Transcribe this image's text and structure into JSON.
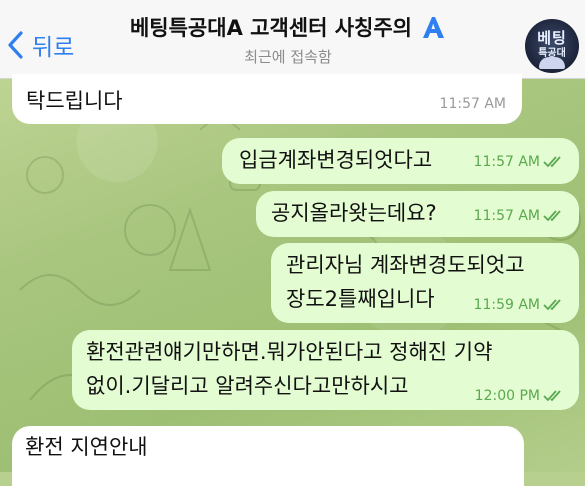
{
  "header": {
    "back_label": "뒤로",
    "title": "베팅특공대A 고객센터 사칭주의",
    "status": "최근에 접속함",
    "avatar_line1": "베팅",
    "avatar_line2": "특공대"
  },
  "messages": [
    {
      "direction": "in",
      "lines": [
        "탁드립니다"
      ],
      "time": "11:57 AM"
    },
    {
      "direction": "out",
      "lines": [
        "입금계좌변경되엇다고"
      ],
      "time": "11:57 AM"
    },
    {
      "direction": "out",
      "lines": [
        "공지올라왓는데요?"
      ],
      "time": "11:57 AM"
    },
    {
      "direction": "out",
      "lines": [
        "관리자님 계좌변경도되엇고",
        "장도2틀째입니다"
      ],
      "time": "11:59 AM"
    },
    {
      "direction": "out",
      "lines": [
        "환전관련얘기만하면.뭐가안된다고 정해진 기약",
        "없이.기달리고 알려주신다고만하시고"
      ],
      "time": "12:00 PM"
    },
    {
      "direction": "in",
      "lines": [
        "환전 지연안내"
      ],
      "time": ""
    }
  ],
  "colors": {
    "accent": "#2f7ff0",
    "incoming_bubble": "#ffffff",
    "outgoing_bubble": "#e3fcd2",
    "read_check": "#5aa84f"
  }
}
